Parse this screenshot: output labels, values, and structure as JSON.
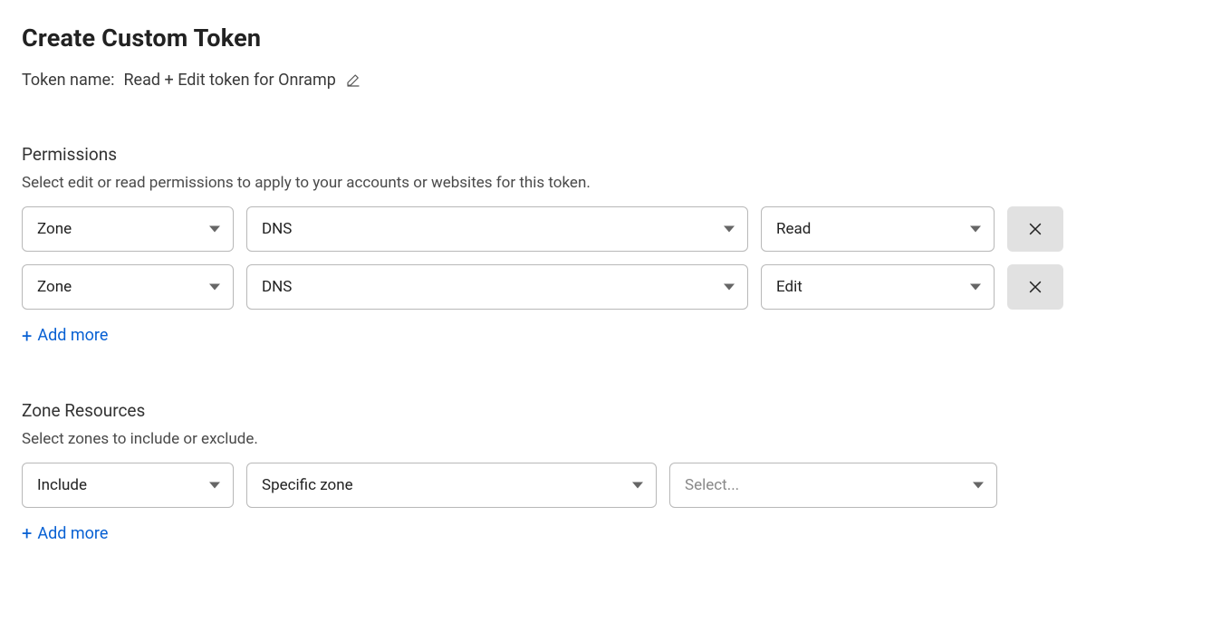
{
  "page_title": "Create Custom Token",
  "token_name_label": "Token name:",
  "token_name_value": "Read + Edit token for Onramp",
  "permissions": {
    "title": "Permissions",
    "description": "Select edit or read permissions to apply to your accounts or websites for this token.",
    "rows": [
      {
        "scope": "Zone",
        "type": "DNS",
        "level": "Read"
      },
      {
        "scope": "Zone",
        "type": "DNS",
        "level": "Edit"
      }
    ],
    "add_more_label": "Add more"
  },
  "zone_resources": {
    "title": "Zone Resources",
    "description": "Select zones to include or exclude.",
    "rows": [
      {
        "mode": "Include",
        "selector": "Specific zone",
        "target_placeholder": "Select..."
      }
    ],
    "add_more_label": "Add more"
  }
}
